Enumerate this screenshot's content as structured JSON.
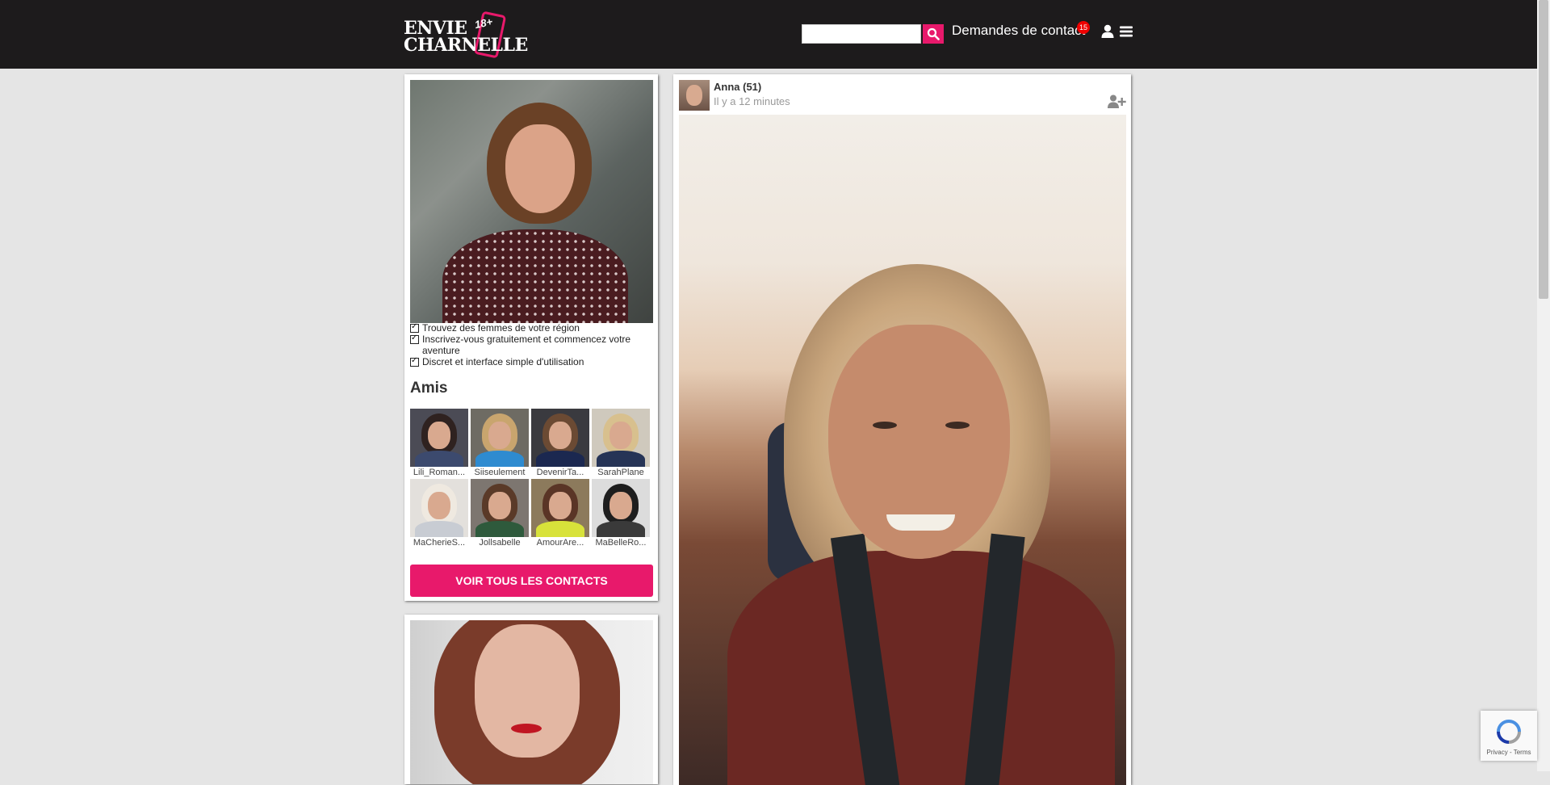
{
  "header": {
    "logo_line1": "ENVIE",
    "logo_line2": "CHARNELLE",
    "logo_age": "18+",
    "search_placeholder": "",
    "contact_requests_label": "Demandes de contact",
    "contact_requests_count": "15",
    "icons": [
      "search-icon",
      "user-icon",
      "menu-icon"
    ]
  },
  "sidebar": {
    "features": [
      "Trouvez des femmes de votre région",
      "Inscrivez-vous gratuitement et commencez votre aventure",
      "Discret et interface simple d'utilisation"
    ],
    "friends_title": "Amis",
    "friends": [
      {
        "name": "Lili_Roman..."
      },
      {
        "name": "Siiseulement"
      },
      {
        "name": "DevenirTa..."
      },
      {
        "name": "SarahPlane"
      },
      {
        "name": "MaCherieS..."
      },
      {
        "name": "Jollsabelle"
      },
      {
        "name": "AmourAre..."
      },
      {
        "name": "MaBelleRo..."
      }
    ],
    "cta_label": "VOIR TOUS LES CONTACTS"
  },
  "post": {
    "author": "Anna (51)",
    "time": "Il y a 12 minutes"
  },
  "recaptcha": {
    "links": "Privacy - Terms"
  },
  "colors": {
    "accent": "#e8196b",
    "header_bg": "#1d1b1c",
    "page_bg": "#e5e5e5",
    "badge": "#ee0000"
  }
}
